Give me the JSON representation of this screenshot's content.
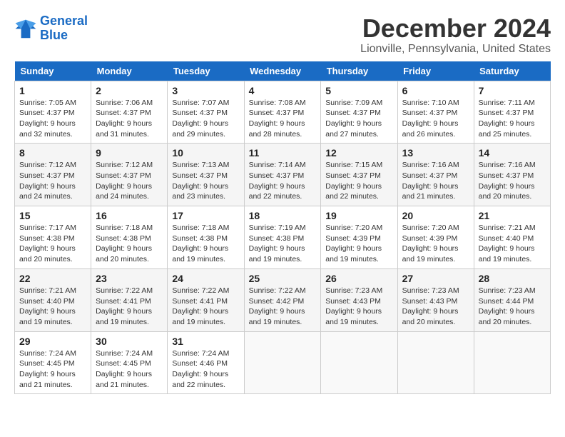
{
  "logo": {
    "line1": "General",
    "line2": "Blue"
  },
  "title": "December 2024",
  "location": "Lionville, Pennsylvania, United States",
  "headers": [
    "Sunday",
    "Monday",
    "Tuesday",
    "Wednesday",
    "Thursday",
    "Friday",
    "Saturday"
  ],
  "weeks": [
    [
      {
        "day": "1",
        "sunrise": "7:05 AM",
        "sunset": "4:37 PM",
        "daylight": "9 hours and 32 minutes."
      },
      {
        "day": "2",
        "sunrise": "7:06 AM",
        "sunset": "4:37 PM",
        "daylight": "9 hours and 31 minutes."
      },
      {
        "day": "3",
        "sunrise": "7:07 AM",
        "sunset": "4:37 PM",
        "daylight": "9 hours and 29 minutes."
      },
      {
        "day": "4",
        "sunrise": "7:08 AM",
        "sunset": "4:37 PM",
        "daylight": "9 hours and 28 minutes."
      },
      {
        "day": "5",
        "sunrise": "7:09 AM",
        "sunset": "4:37 PM",
        "daylight": "9 hours and 27 minutes."
      },
      {
        "day": "6",
        "sunrise": "7:10 AM",
        "sunset": "4:37 PM",
        "daylight": "9 hours and 26 minutes."
      },
      {
        "day": "7",
        "sunrise": "7:11 AM",
        "sunset": "4:37 PM",
        "daylight": "9 hours and 25 minutes."
      }
    ],
    [
      {
        "day": "8",
        "sunrise": "7:12 AM",
        "sunset": "4:37 PM",
        "daylight": "9 hours and 24 minutes."
      },
      {
        "day": "9",
        "sunrise": "7:12 AM",
        "sunset": "4:37 PM",
        "daylight": "9 hours and 24 minutes."
      },
      {
        "day": "10",
        "sunrise": "7:13 AM",
        "sunset": "4:37 PM",
        "daylight": "9 hours and 23 minutes."
      },
      {
        "day": "11",
        "sunrise": "7:14 AM",
        "sunset": "4:37 PM",
        "daylight": "9 hours and 22 minutes."
      },
      {
        "day": "12",
        "sunrise": "7:15 AM",
        "sunset": "4:37 PM",
        "daylight": "9 hours and 22 minutes."
      },
      {
        "day": "13",
        "sunrise": "7:16 AM",
        "sunset": "4:37 PM",
        "daylight": "9 hours and 21 minutes."
      },
      {
        "day": "14",
        "sunrise": "7:16 AM",
        "sunset": "4:37 PM",
        "daylight": "9 hours and 20 minutes."
      }
    ],
    [
      {
        "day": "15",
        "sunrise": "7:17 AM",
        "sunset": "4:38 PM",
        "daylight": "9 hours and 20 minutes."
      },
      {
        "day": "16",
        "sunrise": "7:18 AM",
        "sunset": "4:38 PM",
        "daylight": "9 hours and 20 minutes."
      },
      {
        "day": "17",
        "sunrise": "7:18 AM",
        "sunset": "4:38 PM",
        "daylight": "9 hours and 19 minutes."
      },
      {
        "day": "18",
        "sunrise": "7:19 AM",
        "sunset": "4:38 PM",
        "daylight": "9 hours and 19 minutes."
      },
      {
        "day": "19",
        "sunrise": "7:20 AM",
        "sunset": "4:39 PM",
        "daylight": "9 hours and 19 minutes."
      },
      {
        "day": "20",
        "sunrise": "7:20 AM",
        "sunset": "4:39 PM",
        "daylight": "9 hours and 19 minutes."
      },
      {
        "day": "21",
        "sunrise": "7:21 AM",
        "sunset": "4:40 PM",
        "daylight": "9 hours and 19 minutes."
      }
    ],
    [
      {
        "day": "22",
        "sunrise": "7:21 AM",
        "sunset": "4:40 PM",
        "daylight": "9 hours and 19 minutes."
      },
      {
        "day": "23",
        "sunrise": "7:22 AM",
        "sunset": "4:41 PM",
        "daylight": "9 hours and 19 minutes."
      },
      {
        "day": "24",
        "sunrise": "7:22 AM",
        "sunset": "4:41 PM",
        "daylight": "9 hours and 19 minutes."
      },
      {
        "day": "25",
        "sunrise": "7:22 AM",
        "sunset": "4:42 PM",
        "daylight": "9 hours and 19 minutes."
      },
      {
        "day": "26",
        "sunrise": "7:23 AM",
        "sunset": "4:43 PM",
        "daylight": "9 hours and 19 minutes."
      },
      {
        "day": "27",
        "sunrise": "7:23 AM",
        "sunset": "4:43 PM",
        "daylight": "9 hours and 20 minutes."
      },
      {
        "day": "28",
        "sunrise": "7:23 AM",
        "sunset": "4:44 PM",
        "daylight": "9 hours and 20 minutes."
      }
    ],
    [
      {
        "day": "29",
        "sunrise": "7:24 AM",
        "sunset": "4:45 PM",
        "daylight": "9 hours and 21 minutes."
      },
      {
        "day": "30",
        "sunrise": "7:24 AM",
        "sunset": "4:45 PM",
        "daylight": "9 hours and 21 minutes."
      },
      {
        "day": "31",
        "sunrise": "7:24 AM",
        "sunset": "4:46 PM",
        "daylight": "9 hours and 22 minutes."
      },
      null,
      null,
      null,
      null
    ]
  ],
  "labels": {
    "sunrise": "Sunrise:",
    "sunset": "Sunset:",
    "daylight": "Daylight:"
  }
}
